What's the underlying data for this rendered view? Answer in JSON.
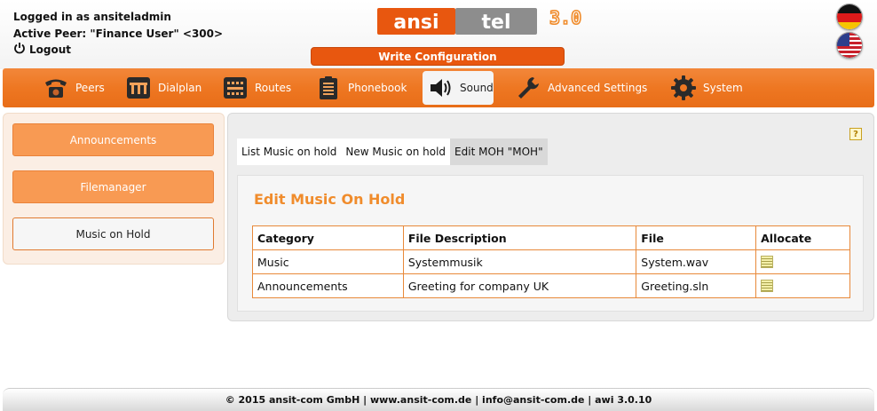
{
  "header": {
    "logged_in": "Logged in as ansiteladmin",
    "active_peer": "Active Peer: \"Finance User\" <300>",
    "logout": "Logout",
    "logo_left": "ansi",
    "logo_right": "tel",
    "logo_version": "3.0",
    "write_config": "Write Configuration"
  },
  "nav": {
    "items": [
      {
        "label": "Peers",
        "icon": "phone-icon"
      },
      {
        "label": "Dialplan",
        "icon": "dialplan-icon"
      },
      {
        "label": "Routes",
        "icon": "routes-icon"
      },
      {
        "label": "Phonebook",
        "icon": "phonebook-icon"
      },
      {
        "label": "Sound",
        "icon": "speaker-icon"
      },
      {
        "label": "Advanced Settings",
        "icon": "wrench-icon"
      },
      {
        "label": "System",
        "icon": "gear-icon"
      }
    ],
    "active": "Sound"
  },
  "sidebar": {
    "items": [
      {
        "label": "Announcements"
      },
      {
        "label": "Filemanager"
      },
      {
        "label": "Music on Hold"
      }
    ]
  },
  "main": {
    "help": "?",
    "tabs": [
      {
        "label": "List Music on hold"
      },
      {
        "label": "New Music on hold"
      },
      {
        "label": "Edit MOH \"MOH\""
      }
    ],
    "title": "Edit Music On Hold",
    "table": {
      "headers": [
        "Category",
        "File Description",
        "File",
        "Allocate"
      ],
      "rows": [
        [
          "Music",
          "Systemmusik",
          "System.wav"
        ],
        [
          "Announcements",
          "Greeting for company UK",
          "Greeting.sln"
        ]
      ]
    }
  },
  "footer": {
    "text": "© 2015 ansit-com GmbH | www.ansit-com.de | info@ansit-com.de | awi 3.0.10"
  },
  "colors": {
    "accent": "#ee7722",
    "write_button": "#e8570f",
    "title": "#f08c2c"
  }
}
